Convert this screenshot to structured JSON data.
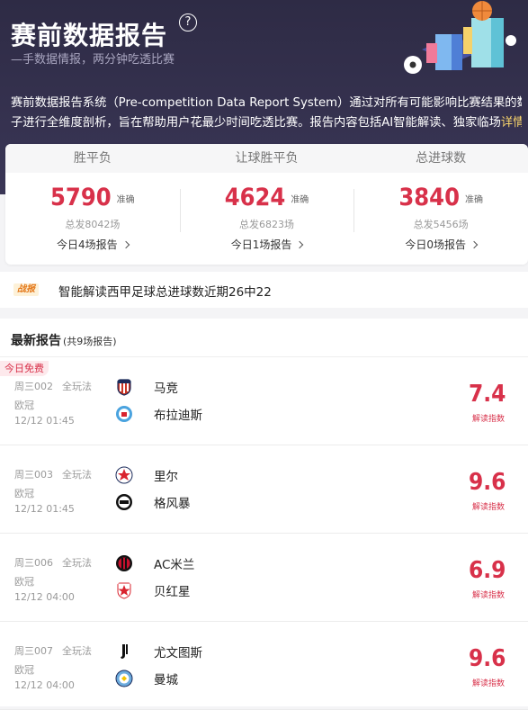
{
  "header": {
    "title": "赛前数据报告",
    "help_icon": "question-circle-icon",
    "subtitle": "—手数据情报，两分钟吃透比赛",
    "desc_line1": "赛前数据报告系统（Pre-competition Data Report System）通过对所有可能影响比赛结果的数据因",
    "desc_line2": "子进行全维度剖析，旨在帮助用户花最少时间吃透比赛。报告内容包括AI智能解读、独家临场",
    "detail_link": "详情>"
  },
  "stats": {
    "columns": [
      {
        "header": "胜平负",
        "value": "5790",
        "unit": "准确",
        "total": "总发8042场",
        "today": "今日4场报告"
      },
      {
        "header": "让球胜平负",
        "value": "4624",
        "unit": "准确",
        "total": "总发6823场",
        "today": "今日1场报告"
      },
      {
        "header": "总进球数",
        "value": "3840",
        "unit": "准确",
        "total": "总发5456场",
        "today": "今日0场报告"
      }
    ]
  },
  "news": {
    "badge": "战报",
    "text": "智能解读西甲足球总进球数近期26中22"
  },
  "reports": {
    "title": "最新报告",
    "count": "(共9场报告)",
    "free_tag": "今日免费",
    "matches": [
      {
        "code": "周三002",
        "play": "全玩法",
        "league": "欧冠",
        "time": "12/12 01:45",
        "home": "马竞",
        "away": "布拉迪斯",
        "score": "7.4",
        "score_label": "解读指数",
        "home_icon": "atletico-crest-icon",
        "away_icon": "bratislava-crest-icon"
      },
      {
        "code": "周三003",
        "play": "全玩法",
        "league": "欧冠",
        "time": "12/12 01:45",
        "home": "里尔",
        "away": "格风暴",
        "score": "9.6",
        "score_label": "解读指数",
        "home_icon": "lille-crest-icon",
        "away_icon": "sturm-graz-crest-icon"
      },
      {
        "code": "周三006",
        "play": "全玩法",
        "league": "欧冠",
        "time": "12/12 04:00",
        "home": "AC米兰",
        "away": "贝红星",
        "score": "6.9",
        "score_label": "解读指数",
        "home_icon": "ac-milan-crest-icon",
        "away_icon": "red-star-crest-icon"
      },
      {
        "code": "周三007",
        "play": "全玩法",
        "league": "欧冠",
        "time": "12/12 04:00",
        "home": "尤文图斯",
        "away": "曼城",
        "score": "9.6",
        "score_label": "解读指数",
        "home_icon": "juventus-crest-icon",
        "away_icon": "man-city-crest-icon"
      }
    ]
  },
  "colors": {
    "accent": "#d8314a",
    "header_bg": "#2e2b45",
    "link": "#f7d36b"
  }
}
